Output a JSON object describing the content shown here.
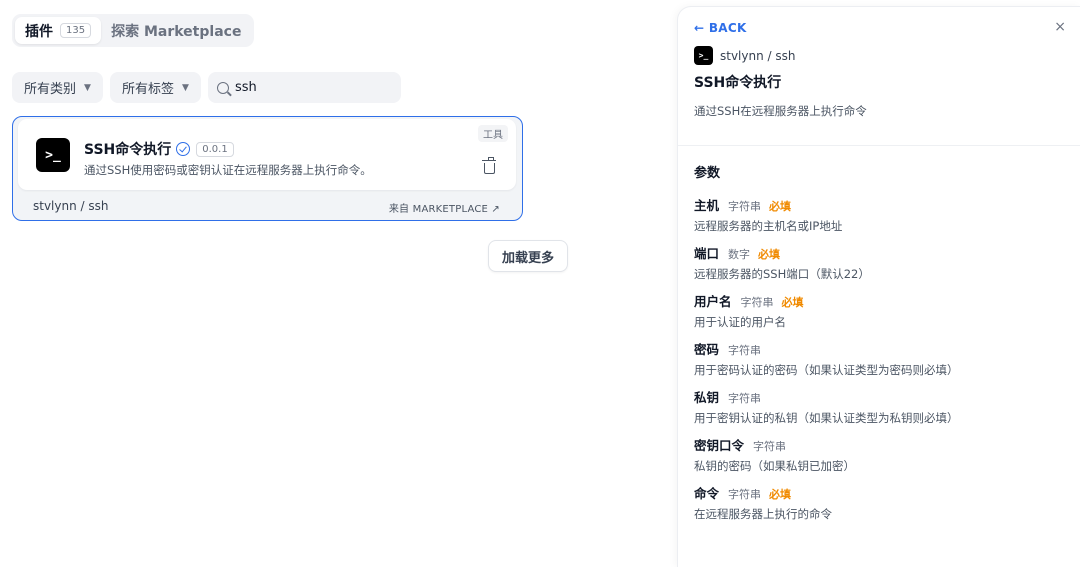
{
  "tabs": {
    "plugins_label": "插件",
    "plugins_count": "135",
    "marketplace_label": "探索 Marketplace"
  },
  "filters": {
    "category_label": "所有类别",
    "tag_label": "所有标签",
    "search_value": "ssh"
  },
  "plugin_card": {
    "icon_text": ">_",
    "title": "SSH命令执行",
    "version": "0.0.1",
    "description": "通过SSH使用密码或密钥认证在远程服务器上执行命令。",
    "type_badge": "工具",
    "author": "stvlynn / ssh",
    "source": "来自 MARKETPLACE ↗"
  },
  "load_more_label": "加载更多",
  "detail_panel": {
    "back_label": "← BACK",
    "close_label": "×",
    "icon_text": ">_",
    "author": "stvlynn / ssh",
    "title": "SSH命令执行",
    "description": "通过SSH在远程服务器上执行命令",
    "params_title": "参数",
    "params": [
      {
        "name": "主机",
        "type": "字符串",
        "required": "必填",
        "desc": "远程服务器的主机名或IP地址"
      },
      {
        "name": "端口",
        "type": "数字",
        "required": "必填",
        "desc": "远程服务器的SSH端口（默认22）"
      },
      {
        "name": "用户名",
        "type": "字符串",
        "required": "必填",
        "desc": "用于认证的用户名"
      },
      {
        "name": "密码",
        "type": "字符串",
        "required": "",
        "desc": "用于密码认证的密码（如果认证类型为密码则必填）"
      },
      {
        "name": "私钥",
        "type": "字符串",
        "required": "",
        "desc": "用于密钥认证的私钥（如果认证类型为私钥则必填）"
      },
      {
        "name": "密钥口令",
        "type": "字符串",
        "required": "",
        "desc": "私钥的密码（如果私钥已加密）"
      },
      {
        "name": "命令",
        "type": "字符串",
        "required": "必填",
        "desc": "在远程服务器上执行的命令"
      }
    ]
  }
}
